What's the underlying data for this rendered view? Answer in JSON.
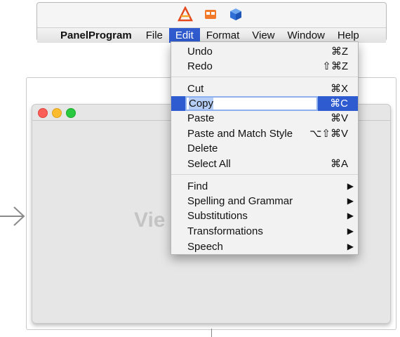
{
  "toolbar": {
    "icons": [
      "app-store-icon",
      "box-icon",
      "cube-icon"
    ]
  },
  "menubar": {
    "app_name": "PanelProgram",
    "items": [
      "File",
      "Edit",
      "Format",
      "View",
      "Window",
      "Help"
    ],
    "active": "Edit"
  },
  "edit_menu": {
    "undo": {
      "label": "Undo",
      "shortcut": "⌘Z"
    },
    "redo": {
      "label": "Redo",
      "shortcut": "⇧⌘Z"
    },
    "cut": {
      "label": "Cut",
      "shortcut": "⌘X"
    },
    "copy": {
      "label": "Copy",
      "shortcut": "⌘C"
    },
    "paste": {
      "label": "Paste",
      "shortcut": "⌘V"
    },
    "paste_match": {
      "label": "Paste and Match Style",
      "shortcut": "⌥⇧⌘V"
    },
    "delete": {
      "label": "Delete"
    },
    "select_all": {
      "label": "Select All",
      "shortcut": "⌘A"
    },
    "find": {
      "label": "Find"
    },
    "spelling": {
      "label": "Spelling and Grammar"
    },
    "substitutions": {
      "label": "Substitutions"
    },
    "transformations": {
      "label": "Transformations"
    },
    "speech": {
      "label": "Speech"
    },
    "submenu_arrow": "▶"
  },
  "canvas": {
    "view_text": "Vie"
  },
  "colors": {
    "accent": "#2e5cd0",
    "close": "#fc5f57",
    "minimize": "#fdbc2e",
    "zoom": "#28c840"
  }
}
